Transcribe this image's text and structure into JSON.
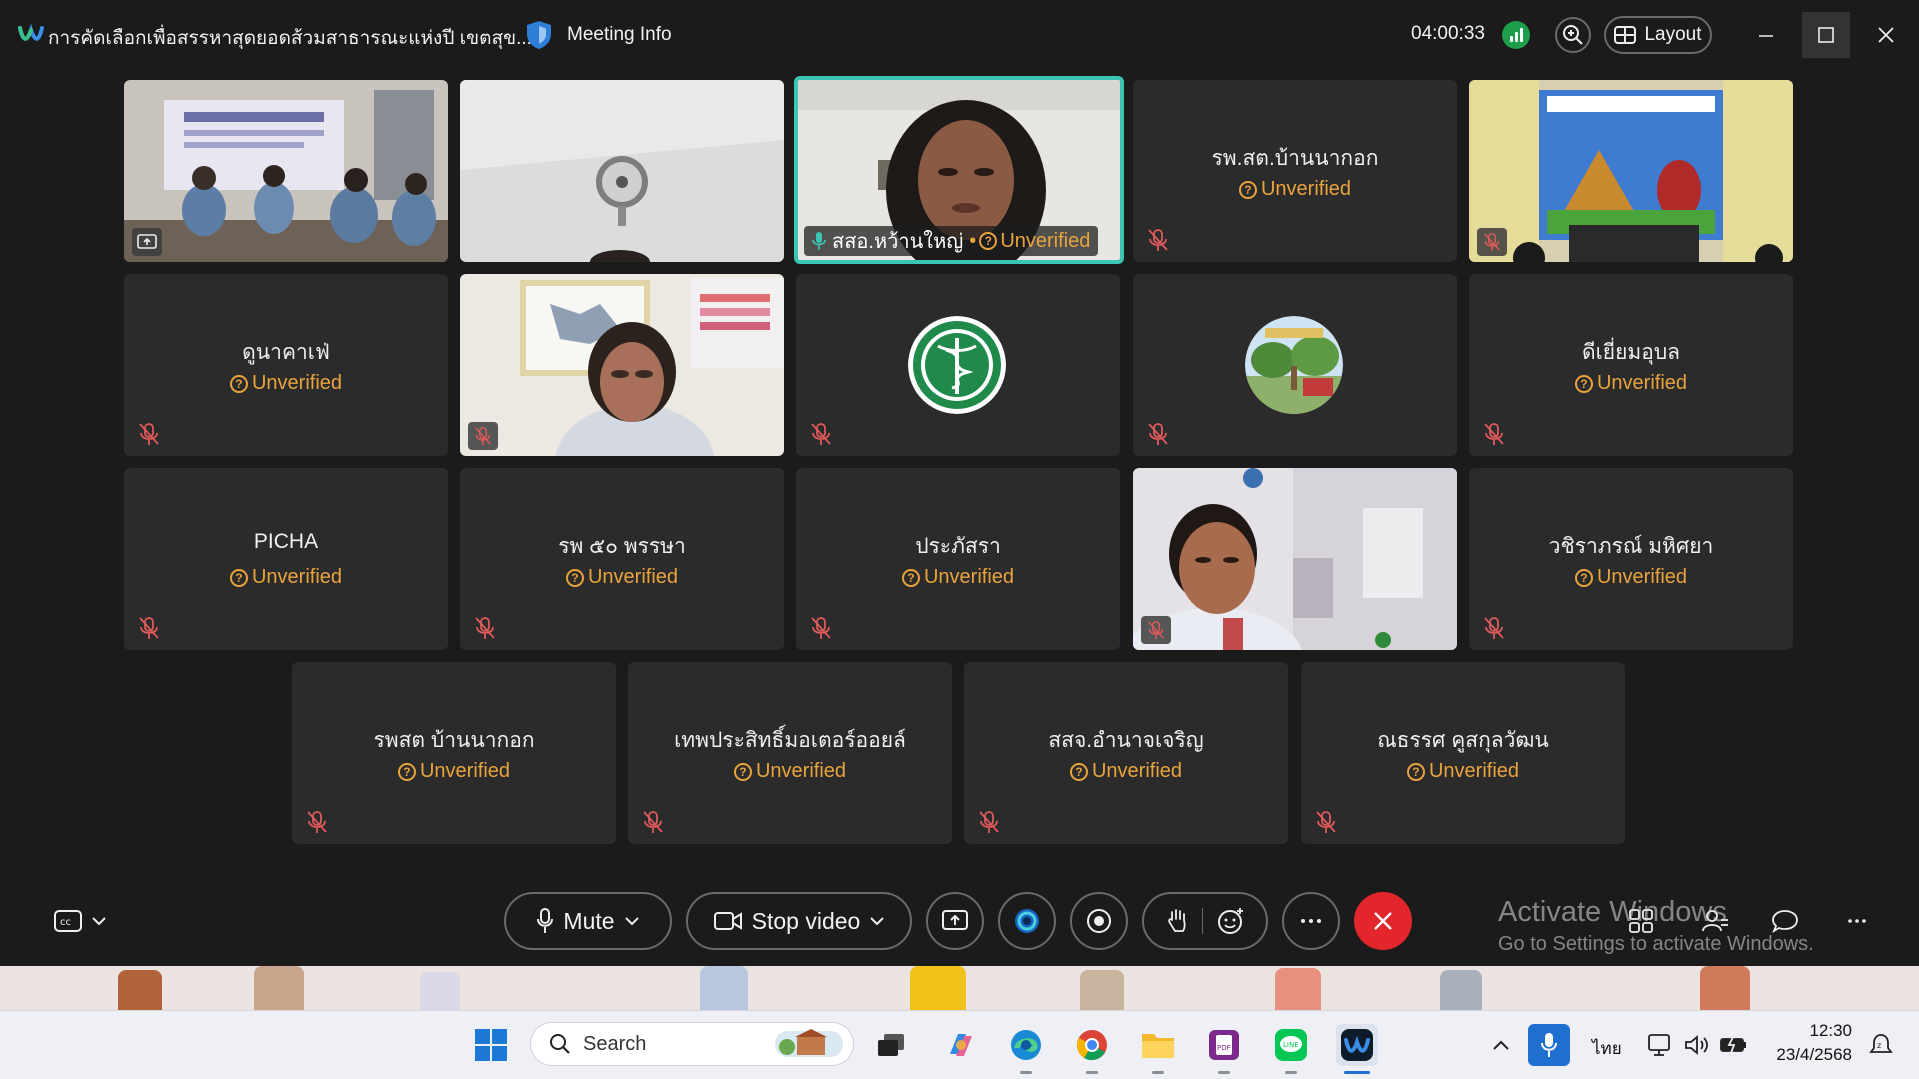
{
  "window": {
    "meeting_title": "การคัดเลือกเพื่อสรรหาสุดยอดส้วมสาธารณะแห่งปี เขตสุข...",
    "meeting_info": "Meeting Info",
    "timer": "04:00:33",
    "layout_label": "Layout"
  },
  "tiles": {
    "t1": {
      "status": ""
    },
    "t3": {
      "name": "สสอ.หว้านใหญ่",
      "status": "Unverified"
    },
    "t4": {
      "name": "รพ.สต.บ้านนากอก",
      "status": "Unverified"
    },
    "t6": {
      "name": "ดูนาคาเฟ่",
      "status": "Unverified"
    },
    "t10": {
      "name": "ดีเยี่ยมอุบล",
      "status": "Unverified"
    },
    "t11": {
      "name": "PICHA",
      "status": "Unverified"
    },
    "t12": {
      "name": "รพ ๕๐ พรรษา",
      "status": "Unverified"
    },
    "t13": {
      "name": "ประภัสรา",
      "status": "Unverified"
    },
    "t15": {
      "name": "วชิราภรณ์ มหิศยา",
      "status": "Unverified"
    },
    "t16": {
      "name": "รพสต บ้านนากอก",
      "status": "Unverified"
    },
    "t17": {
      "name": "เทพประสิทธิ์มอเตอร์ออยล์",
      "status": "Unverified"
    },
    "t18": {
      "name": "สสจ.อำนาจเจริญ",
      "status": "Unverified"
    },
    "t19": {
      "name": "ณธรรศ คูสกุลวัฒน",
      "status": "Unverified"
    }
  },
  "controls": {
    "mute_label": "Mute",
    "stop_video_label": "Stop video"
  },
  "watermark": {
    "line1": "Activate Windows",
    "line2": "Go to Settings to activate Windows."
  },
  "taskbar": {
    "search_placeholder": "Search",
    "language": "ไทย",
    "time": "12:30",
    "date": "23/4/2568"
  },
  "colors": {
    "unverified": "#e8a33d",
    "active_speaker_border": "#3bc6b3",
    "end_call": "#e3262c"
  }
}
